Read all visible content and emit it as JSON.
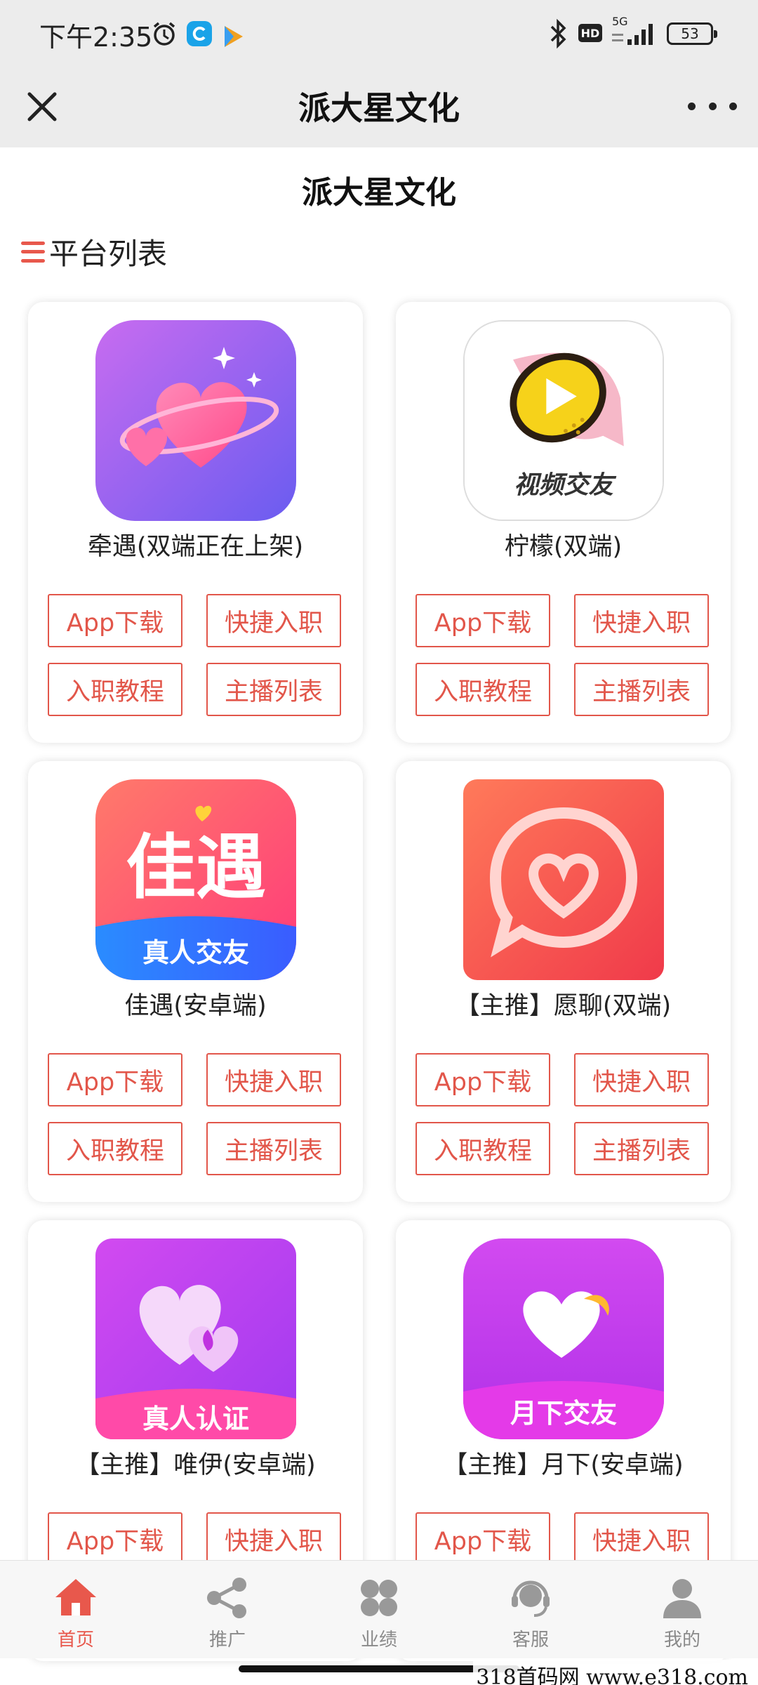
{
  "status": {
    "time": "下午2:35",
    "hd": "HD",
    "network": "5G",
    "battery": "53"
  },
  "nav": {
    "title": "派大星文化"
  },
  "page": {
    "title": "派大星文化"
  },
  "section": {
    "title": "平台列表"
  },
  "buttons": {
    "download": "App下载",
    "join": "快捷入职",
    "tutorial": "入职教程",
    "hosts": "主播列表"
  },
  "platforms": [
    {
      "name": "牵遇(双端正在上架)",
      "icon": "heart-planet-icon"
    },
    {
      "name": "柠檬(双端)",
      "icon": "lemon-video-icon",
      "icon_text": "视频交友"
    },
    {
      "name": "佳遇(安卓端)",
      "icon": "jiayu-icon",
      "icon_text": "佳遇",
      "icon_sub": "真人交友"
    },
    {
      "name": "【主推】愿聊(双端)",
      "icon": "chat-heart-icon"
    },
    {
      "name": "【主推】唯伊(安卓端)",
      "icon": "double-heart-icon",
      "icon_sub": "真人认证"
    },
    {
      "name": "【主推】月下(安卓端)",
      "icon": "moon-heart-icon",
      "icon_sub": "月下交友"
    }
  ],
  "tabs": [
    {
      "label": "首页",
      "icon": "home-icon",
      "active": true
    },
    {
      "label": "推广",
      "icon": "share-icon"
    },
    {
      "label": "业绩",
      "icon": "grid-icon"
    },
    {
      "label": "客服",
      "icon": "headset-icon"
    },
    {
      "label": "我的",
      "icon": "user-icon"
    }
  ],
  "watermark": "318首码网  www.e318.com",
  "colors": {
    "accent": "#e2564a",
    "background": "#ffffff",
    "nav_bg": "#ececec"
  }
}
